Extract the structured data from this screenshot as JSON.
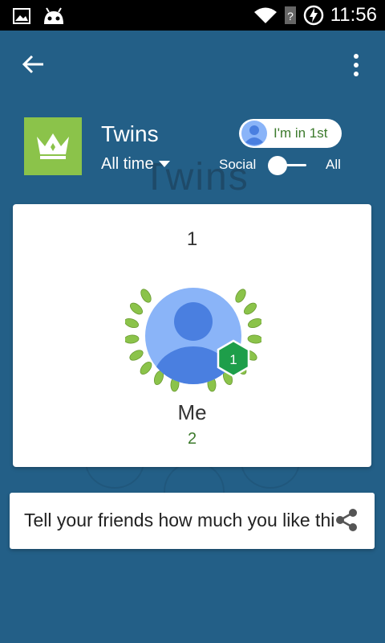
{
  "status_bar": {
    "time": "11:56",
    "icons": [
      "image-icon",
      "android-icon",
      "wifi-icon",
      "signal-unknown-icon",
      "charging-icon"
    ]
  },
  "toolbar": {
    "back_icon": "arrow-left-icon",
    "more_icon": "more-vert-icon"
  },
  "header": {
    "title": "Twins",
    "time_filter": "All time",
    "rank_pill": "I'm in 1st",
    "toggle_left": "Social",
    "toggle_right": "All",
    "watermark": "Twins"
  },
  "leaderboard": {
    "rank": "1",
    "player_name": "Me",
    "score": "2",
    "level": "1"
  },
  "share": {
    "text": "Tell your friends how much you like this",
    "icon": "share-icon"
  },
  "colors": {
    "background": "#235F87",
    "game_icon": "#8BC34A",
    "score_green": "#3c7a2c",
    "level_badge": "#1E9E4A"
  }
}
